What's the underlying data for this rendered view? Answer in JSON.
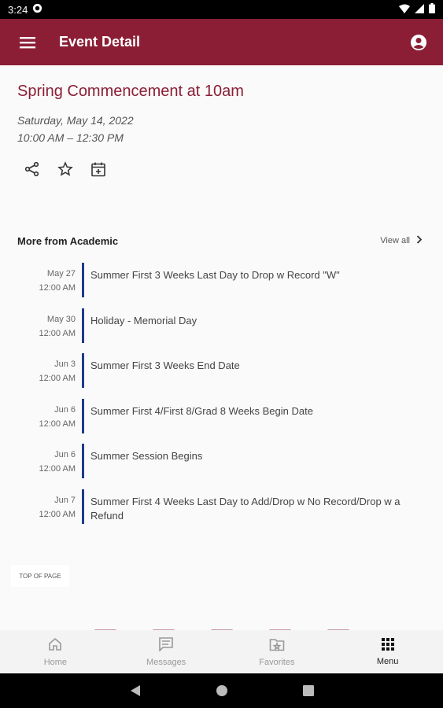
{
  "colors": {
    "brand": "#8b1e35",
    "accent_bar": "#1f3a8a"
  },
  "status_bar": {
    "time": "3:24"
  },
  "app_bar": {
    "title": "Event Detail"
  },
  "event": {
    "title": "Spring Commencement at 10am",
    "date": "Saturday, May 14, 2022",
    "time": "10:00 AM – 12:30 PM"
  },
  "more": {
    "heading": "More from Academic",
    "view_all": "View all",
    "items": [
      {
        "date": "May 27",
        "time": "12:00 AM",
        "title": "Summer First 3 Weeks Last Day to Drop w Record \"W\""
      },
      {
        "date": "May 30",
        "time": "12:00 AM",
        "title": "Holiday - Memorial Day"
      },
      {
        "date": "Jun 3",
        "time": "12:00 AM",
        "title": "Summer First 3 Weeks End Date"
      },
      {
        "date": "Jun 6",
        "time": "12:00 AM",
        "title": "Summer First 4/First 8/Grad 8 Weeks Begin Date"
      },
      {
        "date": "Jun 6",
        "time": "12:00 AM",
        "title": "Summer Session Begins"
      },
      {
        "date": "Jun 7",
        "time": "12:00 AM",
        "title": "Summer First 4 Weeks Last Day to Add/Drop w No Record/Drop w a Refund"
      }
    ]
  },
  "top_of_page": "TOP OF PAGE",
  "bottom_nav": {
    "items": [
      {
        "label": "Home",
        "icon": "home-icon"
      },
      {
        "label": "Messages",
        "icon": "messages-icon"
      },
      {
        "label": "Favorites",
        "icon": "favorites-icon"
      },
      {
        "label": "Menu",
        "icon": "grid-menu-icon",
        "active": true
      }
    ]
  }
}
